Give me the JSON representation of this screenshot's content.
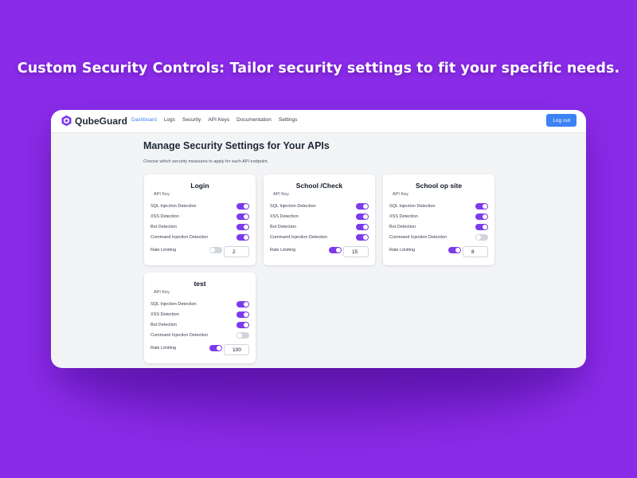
{
  "headline": "Custom Security Controls: Tailor security settings to fit your specific needs.",
  "colors": {
    "background": "#8a2be8",
    "accent": "#7c3aed",
    "primary_button": "#3b82f6",
    "toggle_off": "#d1d5db"
  },
  "app": {
    "brand": "QubeGuard",
    "nav": [
      "Dashboard",
      "Logs",
      "Security",
      "API Keys",
      "Documentation",
      "Settings"
    ],
    "active_nav": "Dashboard",
    "logout_label": "Log out"
  },
  "main": {
    "title": "Manage Security Settings for Your APIs",
    "description": "Choose which security measures to apply for each API endpoint."
  },
  "option_labels": {
    "sql": "SQL Injection Detection",
    "xss": "XSS Detection",
    "bot": "Bot Detection",
    "cmd": "Command Injection Detection",
    "rate": "Rate Limiting"
  },
  "cards": [
    {
      "name": "Login",
      "subtitle": "API Key",
      "sql": true,
      "xss": true,
      "bot": true,
      "cmd": true,
      "rate_enabled": false,
      "rate_value": "2"
    },
    {
      "name": "School /Check",
      "subtitle": "API Key",
      "sql": true,
      "xss": true,
      "bot": true,
      "cmd": true,
      "rate_enabled": true,
      "rate_value": "15"
    },
    {
      "name": "School op site",
      "subtitle": "API Key",
      "sql": true,
      "xss": true,
      "bot": true,
      "cmd": false,
      "rate_enabled": true,
      "rate_value": "8"
    },
    {
      "name": "test",
      "subtitle": "API Key",
      "sql": true,
      "xss": true,
      "bot": true,
      "cmd": false,
      "rate_enabled": true,
      "rate_value": "100"
    }
  ]
}
